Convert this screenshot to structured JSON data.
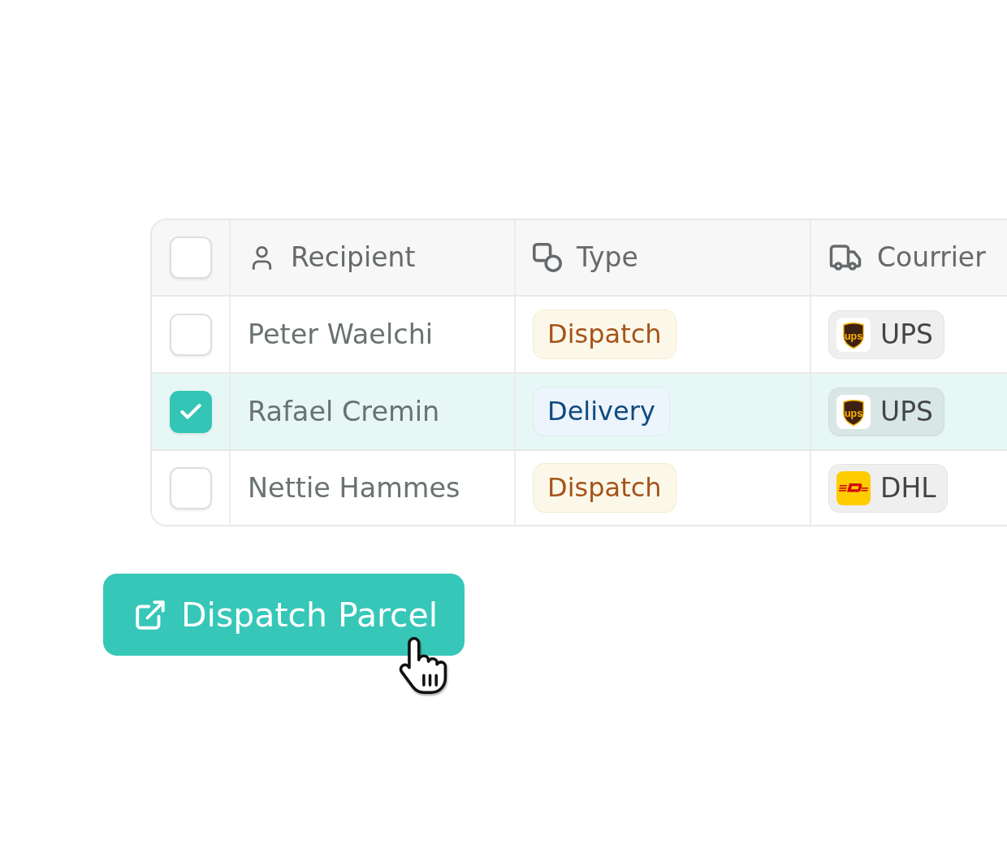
{
  "table": {
    "columns": [
      {
        "kind": "checkbox",
        "checked": false
      },
      {
        "kind": "recipient",
        "label": "Recipient"
      },
      {
        "kind": "type",
        "label": "Type"
      },
      {
        "kind": "courier",
        "label": "Courrier"
      }
    ],
    "rows": [
      {
        "selected": false,
        "recipient": "Peter Waelchi",
        "type": {
          "kind": "dispatch",
          "label": "Dispatch"
        },
        "courier": {
          "name": "UPS",
          "logo": {
            "kind": "shield",
            "text": "ups"
          }
        }
      },
      {
        "selected": true,
        "recipient": "Rafael Cremin",
        "type": {
          "kind": "delivery",
          "label": "Delivery"
        },
        "courier": {
          "name": "UPS",
          "logo": {
            "kind": "shield",
            "text": "ups"
          }
        }
      },
      {
        "selected": false,
        "recipient": "Nettie Hammes",
        "type": {
          "kind": "dispatch",
          "label": "Dispatch"
        },
        "courier": {
          "name": "DHL",
          "logo": {
            "kind": "stripes"
          }
        }
      }
    ]
  },
  "button": {
    "label": "Dispatch Parcel",
    "hovered": true
  }
}
